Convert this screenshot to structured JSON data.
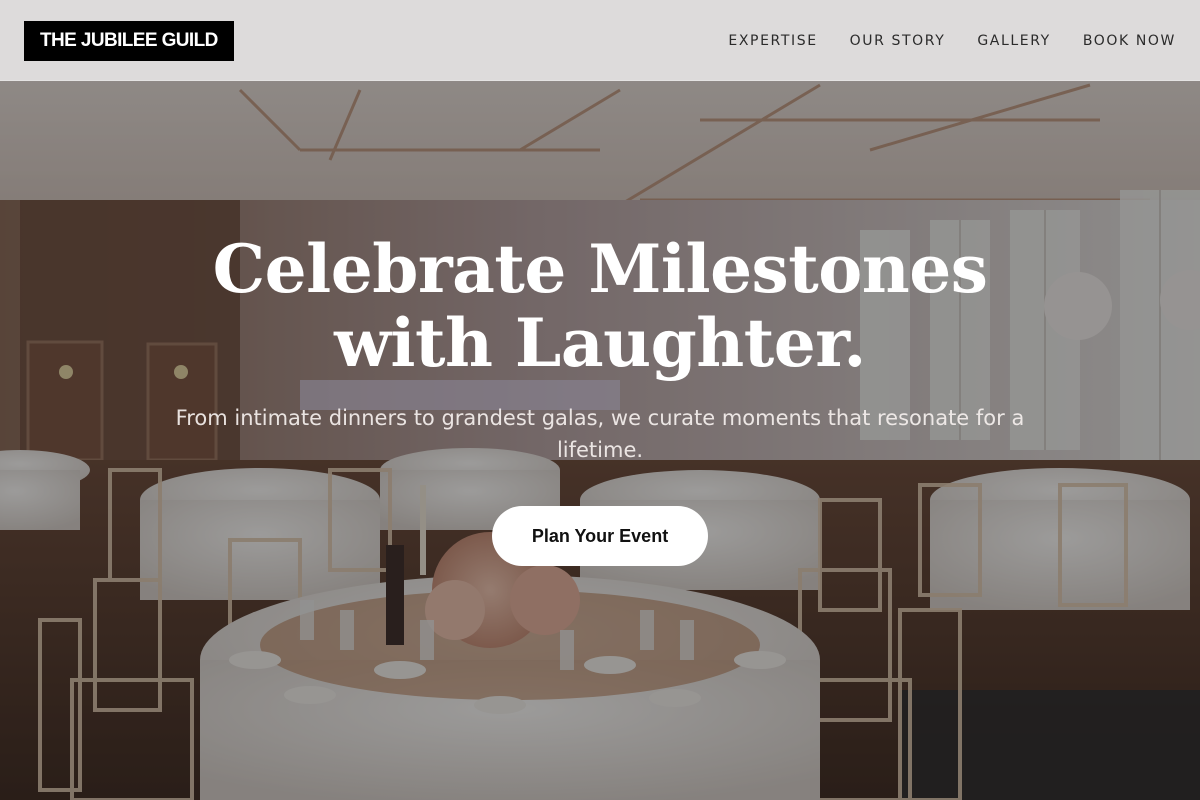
{
  "brand": {
    "logo_text": "THE JUBILEE GUILD"
  },
  "nav": {
    "items": [
      {
        "label": "EXPERTISE"
      },
      {
        "label": "OUR STORY"
      },
      {
        "label": "GALLERY"
      },
      {
        "label": "BOOK NOW"
      }
    ]
  },
  "hero": {
    "headline_line1": "Celebrate Milestones",
    "headline_line2": "with Laughter.",
    "subtitle": "From intimate dinners to grandest galas, we curate moments that resonate for a lifetime.",
    "cta_label": "Plan Your Event",
    "background_image": "banquet-hall-with-round-tables"
  },
  "colors": {
    "header_bg": "#ECEAEB",
    "logo_bg": "#000000",
    "cta_bg": "#FFFFFF",
    "headline": "#FFFFFF"
  }
}
